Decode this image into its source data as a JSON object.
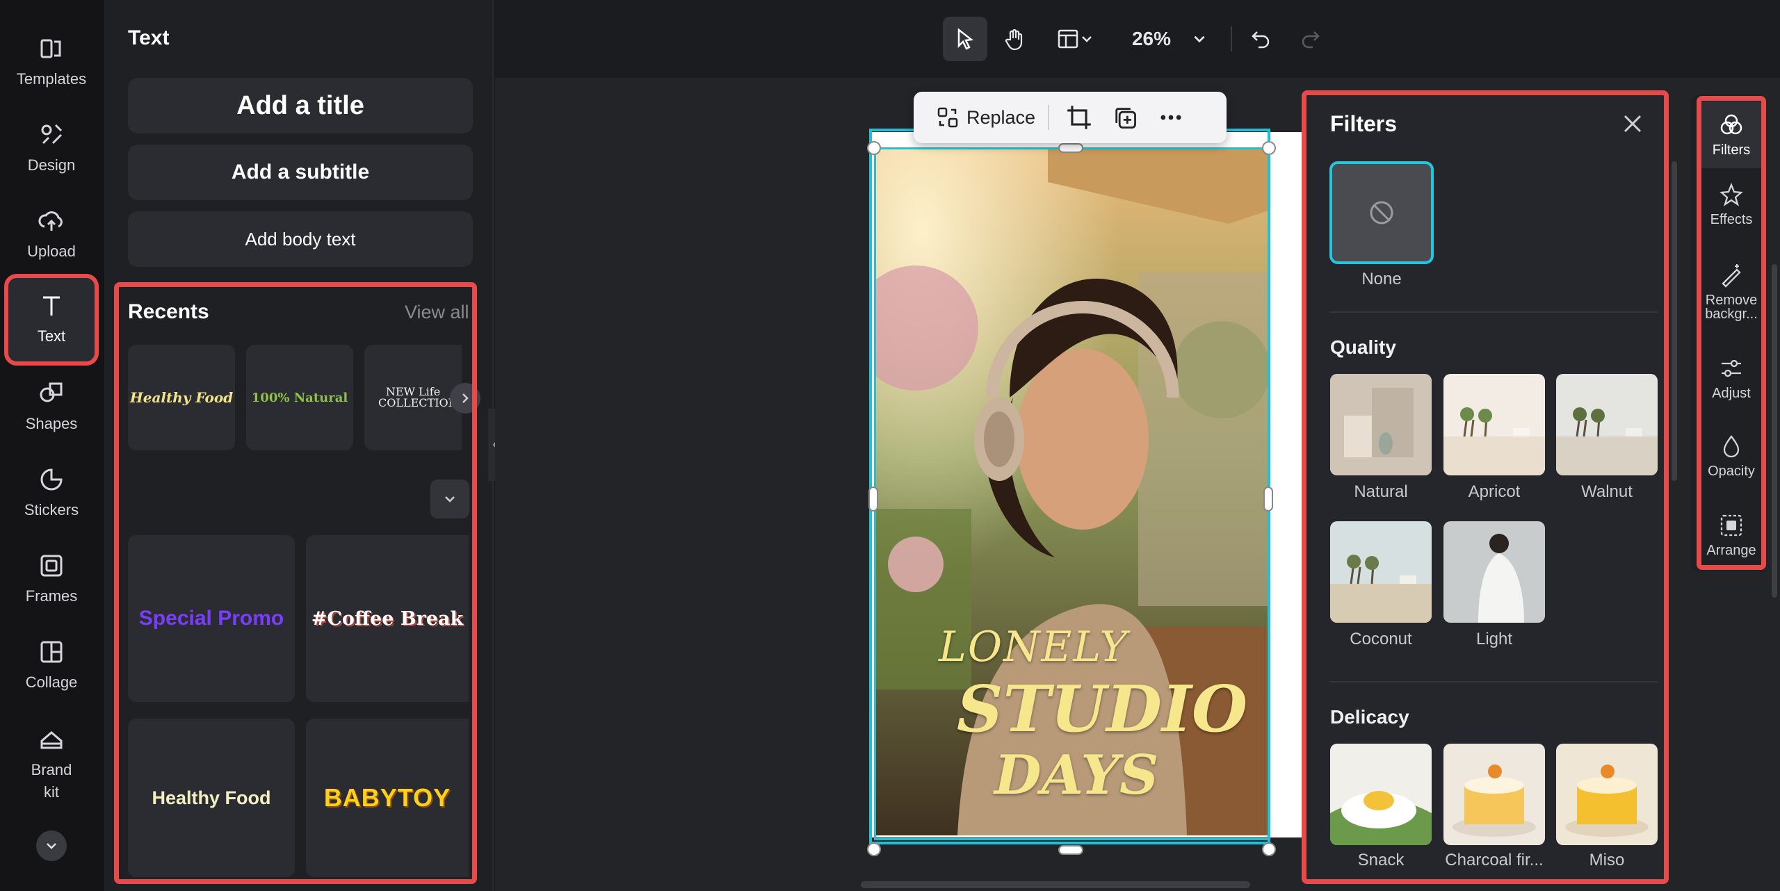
{
  "rail": {
    "items": [
      {
        "label": "Templates",
        "icon": "templates-icon"
      },
      {
        "label": "Design",
        "icon": "design-icon"
      },
      {
        "label": "Upload",
        "icon": "upload-icon"
      },
      {
        "label": "Text",
        "icon": "text-icon",
        "active": true
      },
      {
        "label": "Shapes",
        "icon": "shapes-icon"
      },
      {
        "label": "Stickers",
        "icon": "stickers-icon"
      },
      {
        "label": "Frames",
        "icon": "frames-icon"
      },
      {
        "label": "Collage",
        "icon": "collage-icon"
      },
      {
        "label": "Brand\nkit",
        "icon": "brand-kit-icon"
      }
    ]
  },
  "panel": {
    "title": "Text",
    "add_title": "Add a title",
    "add_subtitle": "Add a subtitle",
    "add_body": "Add body text",
    "recents_title": "Recents",
    "view_all": "View all",
    "recents_row": [
      "Healthy Food",
      "100% Natural",
      "NEW Life COLLECTION"
    ],
    "grid": [
      "Special Promo",
      "#Coffee Break",
      "Healthy Food",
      "BABYTOY"
    ]
  },
  "toolbar": {
    "zoom": "26%"
  },
  "canvas": {
    "line1": "LONELY",
    "line2": "STUDIO",
    "line3": "DAYS",
    "replace_label": "Replace"
  },
  "filters": {
    "title": "Filters",
    "none_label": "None",
    "quality_title": "Quality",
    "quality": [
      "Natural",
      "Apricot",
      "Walnut",
      "Coconut",
      "Light"
    ],
    "delicacy_title": "Delicacy",
    "delicacy": [
      "Snack",
      "Charcoal fir...",
      "Miso"
    ]
  },
  "props": {
    "items": [
      "Filters",
      "Effects",
      "Remove backgr...",
      "Adjust",
      "Opacity",
      "Arrange"
    ]
  },
  "colors": {
    "highlight": "#e84a4a",
    "selection": "#20c0d8",
    "accent_text": "#f6e68c"
  }
}
